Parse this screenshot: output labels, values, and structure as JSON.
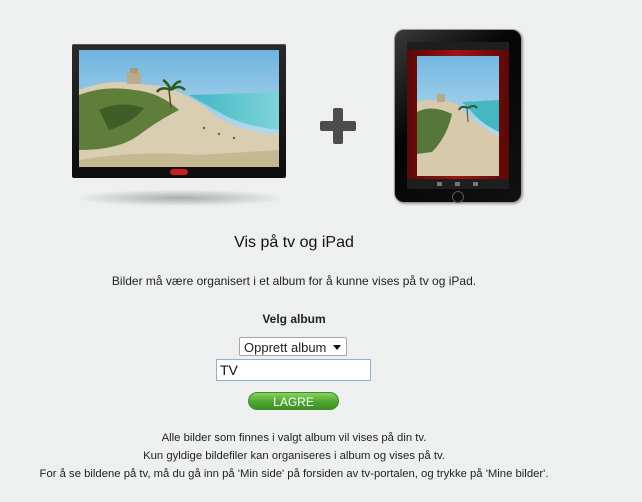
{
  "title": "Vis på tv og iPad",
  "description": "Bilder må være organisert i et album for å kunne vises på tv og iPad.",
  "album": {
    "label": "Velg album",
    "selected": "Opprett album",
    "new_album_name": "TV"
  },
  "save_label": "LAGRE",
  "info_lines": [
    "Alle bilder som finnes i valgt album vil vises på din tv.",
    "Kun gyldige bildefiler kan organiseres i album og vises på tv.",
    "For å se bildene på tv, må du gå inn på 'Min side' på forsiden av tv-portalen, og trykke på 'Mine bilder'."
  ],
  "colors": {
    "background": "#eef0f0",
    "button_green": "#4ea630",
    "tv_logo": "#c81e1e",
    "ipad_frame_red": "#8a1010"
  },
  "icons": [
    "tv-icon",
    "plus-icon",
    "ipad-icon",
    "chevron-down-icon"
  ]
}
